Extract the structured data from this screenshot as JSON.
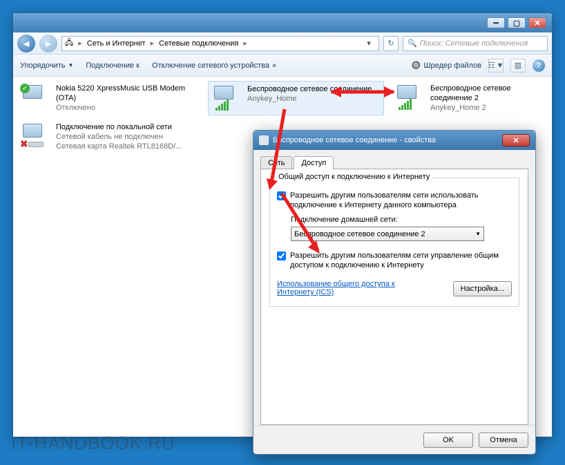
{
  "breadcrumb": {
    "a": "Сеть и Интернет",
    "b": "Сетевые подключения"
  },
  "search": {
    "placeholder": "Поиск: Сетевые подключения"
  },
  "toolbar": {
    "organize": "Упорядочить",
    "connect": "Подключение к",
    "disable": "Отключение сетевого устройства",
    "shredder": "Шредер файлов"
  },
  "items": {
    "nokia": {
      "name": "Nokia 5220 XpressMusic USB Modem (OTA)",
      "sub1": "Отключено"
    },
    "wifi1": {
      "name": "Беспроводное сетевое соединение",
      "sub1": "Anykey_Home"
    },
    "wifi2": {
      "name": "Беспроводное сетевое соединение 2",
      "sub1": "Anykey_Home 2"
    },
    "lan": {
      "name": "Подключение по локальной сети",
      "sub1": "Сетевой кабель не подключен",
      "sub2": "Сетевая карта Realtek RTL8168D/..."
    }
  },
  "dialog": {
    "title": "Беспроводное сетевое соединение - свойства",
    "tab_net": "Сеть",
    "tab_share": "Доступ",
    "group_legend": "Общий доступ к подключению к Интернету",
    "chk1": "Разрешить другим пользователям сети использовать подключение к Интернету данного компьютера",
    "home_label": "Подключение домашней сети:",
    "combo_value": "Беспроводное сетевое соединение 2",
    "chk2": "Разрешить другим пользователям сети управление общим доступом к подключению к Интернету",
    "ics_link": "Использование общего доступа к Интернету (ICS)",
    "settings_btn": "Настройка...",
    "ok": "OK",
    "cancel": "Отмена"
  },
  "watermark": "IT-HANDBOOK.RU"
}
